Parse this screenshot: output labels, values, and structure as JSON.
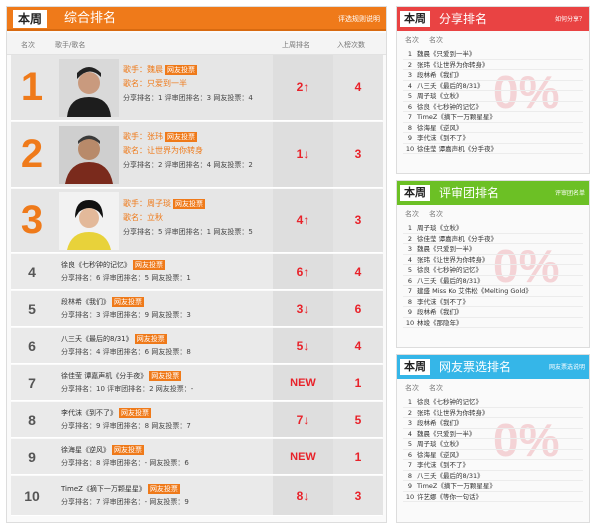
{
  "main": {
    "tag": "本周",
    "title": "综合排名",
    "link": "评选规则说明",
    "col_rank": "名次",
    "col_song": "歌手/歌名",
    "col_last": "上周排名",
    "col_votes": "入榜次数",
    "top": [
      {
        "rank": "1",
        "singer": "歌手：魏晨",
        "song": "歌名：只爱到一半",
        "stats": "分享排名：1  评审团排名：3  网友投票：4",
        "move": "2↑",
        "votes": "4"
      },
      {
        "rank": "2",
        "singer": "歌手：张玮",
        "song": "歌名：让世界为你转身",
        "stats": "分享排名：2  评审团排名：4  网友投票：2",
        "move": "1↓",
        "votes": "3"
      },
      {
        "rank": "3",
        "singer": "歌手：周子琰",
        "song": "歌名：立秋",
        "stats": "分享排名：5  评审团排名：1  网友投票：5",
        "move": "4↑",
        "votes": "3"
      }
    ],
    "rest": [
      {
        "rank": "4",
        "title": "徐良《七秒钟的记忆》",
        "stats": "分享排名：6  评审团排名：5  网友投票：1",
        "move": "6↑",
        "votes": "4"
      },
      {
        "rank": "5",
        "title": "段林希《我们》",
        "stats": "分享排名：3  评审团排名：9  网友投票：3",
        "move": "3↓",
        "votes": "6"
      },
      {
        "rank": "6",
        "title": "八三夭《最后的8/31》",
        "stats": "分享排名：4  评审团排名：6  网友投票：8",
        "move": "5↓",
        "votes": "4"
      },
      {
        "rank": "7",
        "title": "徐佳莹 谭嘉声机《分手夜》",
        "stats": "分享排名：10  评审团排名：2  网友投票：-",
        "move": "NEW",
        "votes": "1"
      },
      {
        "rank": "8",
        "title": "李代沫《到不了》",
        "stats": "分享排名：9  评审团排名：8  网友投票：7",
        "move": "7↓",
        "votes": "5"
      },
      {
        "rank": "9",
        "title": "徐海星《逆风》",
        "stats": "分享排名：8  评审团排名：-  网友投票：6",
        "move": "NEW",
        "votes": "1"
      },
      {
        "rank": "10",
        "title": "TimeZ《摘下一万颗星星》",
        "stats": "分享排名：7  评审团排名：-  网友投票：9",
        "move": "8↓",
        "votes": "3"
      }
    ],
    "vote_badge": "网友投票"
  },
  "share": {
    "tag": "本周",
    "title": "分享排名",
    "link": "如何分享？",
    "col_rank": "名次",
    "col_name": "名次",
    "watermark": "0%",
    "items": [
      "魏晨《只爱到一半》",
      "张玮《让世界为你转身》",
      "段林希《我们》",
      "八三夭《最后的8/31》",
      "周子琰《立秋》",
      "徐良《七秒钟的记忆》",
      "TimeZ《摘下一万颗星星》",
      "徐海星《逆风》",
      "李代沫《到不了》",
      "徐佳莹 谭嘉声机《分手夜》"
    ]
  },
  "jury": {
    "tag": "本周",
    "title": "评审团排名",
    "link": "评审团名单",
    "col_rank": "名次",
    "col_name": "名次",
    "watermark": "0%",
    "items": [
      "周子琰《立秋》",
      "徐佳莹 谭嘉声机《分手夜》",
      "魏晨《只爱到一半》",
      "张玮《让世界为你转身》",
      "徐良《七秒钟的记忆》",
      "八三夭《最后的8/31》",
      "建盛 Miss Ko 艾伟松《Melting Gold》",
      "李代沫《到不了》",
      "段林希《我们》",
      "林竣《那隐年》"
    ]
  },
  "fans": {
    "tag": "本周",
    "title": "网友票选排名",
    "link": "网友票选说明",
    "col_rank": "名次",
    "col_name": "名次",
    "watermark": "0%",
    "items": [
      "徐良《七秒钟的记忆》",
      "张玮《让世界为你转身》",
      "段林希《我们》",
      "魏晨《只爱到一半》",
      "周子琰《立秋》",
      "徐海星《逆风》",
      "李代沫《到不了》",
      "八三夭《最后的8/31》",
      "TimeZ《摘下一万颗星星》",
      "许艺娜《等你一句话》"
    ]
  },
  "colors": {
    "orange": "#ef7a1a",
    "red": "#e94343",
    "green": "#6cc025",
    "blue": "#35b6e8",
    "accent_text": "#e8222a"
  }
}
